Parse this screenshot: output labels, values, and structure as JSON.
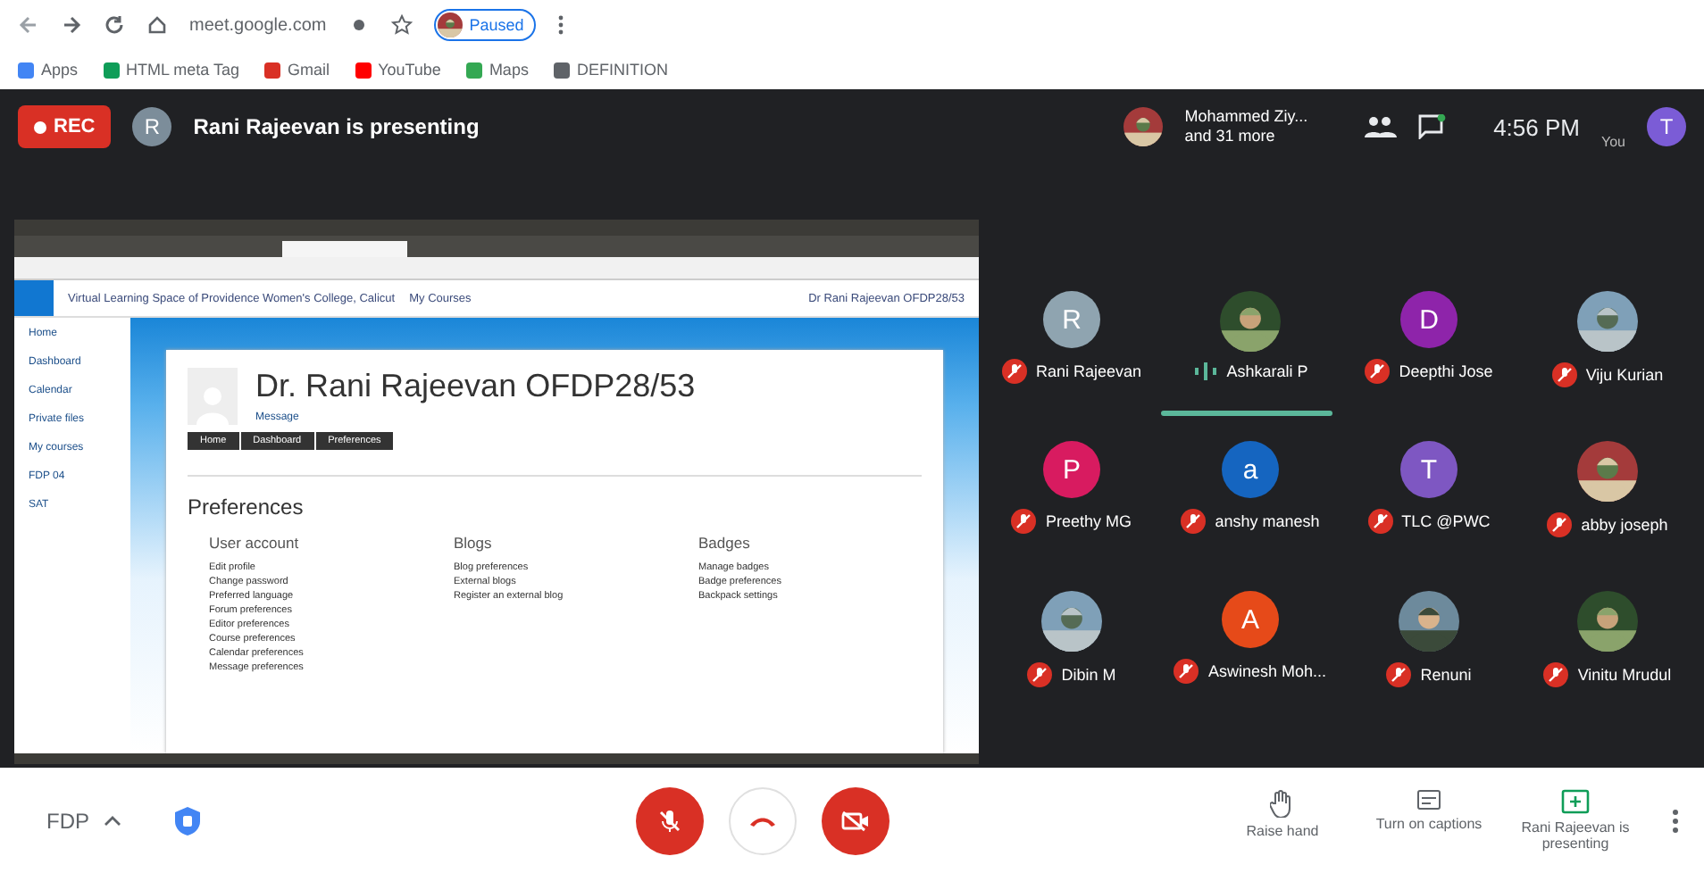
{
  "browser": {
    "url": "meet.google.com",
    "profile": "Paused",
    "bookmarks": [
      {
        "label": "Apps",
        "color": "#4285f4"
      },
      {
        "label": "HTML meta Tag",
        "color": "#0f9d58"
      },
      {
        "label": "Gmail",
        "color": "#d93025"
      },
      {
        "label": "YouTube",
        "color": "#ff0000"
      },
      {
        "label": "Maps",
        "color": "#34a853"
      },
      {
        "label": "DEFINITION",
        "color": "#5f6368"
      }
    ]
  },
  "topbar": {
    "record": "REC",
    "presenter_initial": "R",
    "presenting": "Rani Rajeevan is presenting",
    "others_name": "Mohammed Ziy...",
    "others_count": "and 31 more",
    "time": "4:56 PM",
    "you_label": "You",
    "you_initial": "T"
  },
  "shared_screen": {
    "site": "Virtual Learning Space of Providence Women's College, Calicut",
    "menu": "My Courses",
    "user": "Dr Rani Rajeevan OFDP28/53",
    "nav": [
      "Home",
      "Dashboard",
      "Calendar",
      "Private files",
      "My courses",
      "FDP 04",
      "SAT"
    ],
    "profile_name": "Dr. Rani Rajeevan OFDP28/53",
    "message": "Message",
    "breadcrumbs": [
      "Home",
      "Dashboard",
      "Preferences"
    ],
    "section": "Preferences",
    "groups": [
      {
        "title": "User account",
        "links": [
          "Edit profile",
          "Change password",
          "Preferred language",
          "Forum preferences",
          "Editor preferences",
          "Course preferences",
          "Calendar preferences",
          "Message preferences"
        ]
      },
      {
        "title": "Blogs",
        "links": [
          "Blog preferences",
          "External blogs",
          "Register an external blog"
        ]
      },
      {
        "title": "Badges",
        "links": [
          "Manage badges",
          "Badge preferences",
          "Backpack settings"
        ]
      }
    ]
  },
  "participants": [
    {
      "name": "Rani Rajeevan",
      "kind": "letter",
      "initial": "R",
      "color": "#8fa4b0",
      "muted": true,
      "speaking": false
    },
    {
      "name": "Ashkarali P",
      "kind": "picture",
      "muted": false,
      "speaking": true
    },
    {
      "name": "Deepthi Jose",
      "kind": "letter",
      "initial": "D",
      "color": "#8e24aa",
      "muted": true,
      "speaking": false
    },
    {
      "name": "Viju Kurian",
      "kind": "picture",
      "muted": true,
      "speaking": false
    },
    {
      "name": "Preethy MG",
      "kind": "letter",
      "initial": "P",
      "color": "#d81b60",
      "muted": true,
      "speaking": false
    },
    {
      "name": "anshy manesh",
      "kind": "letter",
      "initial": "a",
      "color": "#1565c0",
      "muted": true,
      "speaking": false
    },
    {
      "name": "TLC @PWC",
      "kind": "letter",
      "initial": "T",
      "color": "#7e57c2",
      "muted": true,
      "speaking": false
    },
    {
      "name": "abby joseph",
      "kind": "picture",
      "muted": true,
      "speaking": false
    },
    {
      "name": "Dibin M",
      "kind": "picture",
      "muted": true,
      "speaking": false
    },
    {
      "name": "Aswinesh Moh...",
      "kind": "letter",
      "initial": "A",
      "color": "#e64a19",
      "muted": true,
      "speaking": false
    },
    {
      "name": "Renuni",
      "kind": "picture",
      "muted": true,
      "speaking": false
    },
    {
      "name": "Vinitu Mrudul",
      "kind": "picture",
      "muted": true,
      "speaking": false
    }
  ],
  "controls": {
    "meeting_code": "FDP",
    "mic_on": false,
    "camera_on": false,
    "actions": [
      {
        "label": "Raise hand",
        "kind": "hand"
      },
      {
        "label": "Turn on captions",
        "kind": "captions"
      },
      {
        "label": "Rani Rajeevan is presenting",
        "kind": "present"
      }
    ]
  }
}
